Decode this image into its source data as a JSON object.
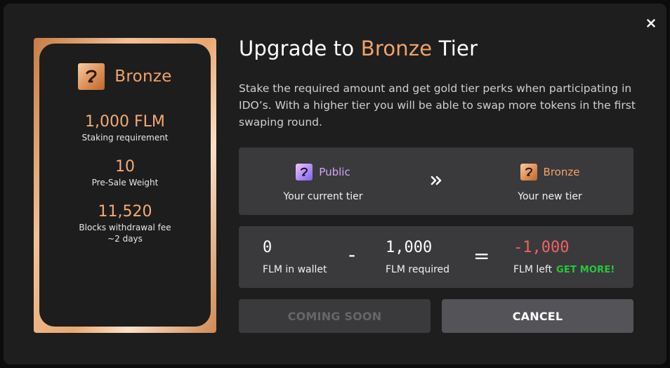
{
  "modal": {
    "close_icon": "close-icon",
    "title": {
      "prefix": "Upgrade to ",
      "tier": "Bronze",
      "suffix": " Tier"
    },
    "description": "Stake the required amount and get gold tier perks when participating in IDO’s. With a higher tier you will be able to swap more tokens in the first swaping round."
  },
  "card": {
    "name": "Bronze",
    "logo_icon": "bronze-tier-logo",
    "stats": [
      {
        "value": "1,000 FLM",
        "label": "Staking requirement"
      },
      {
        "value": "10",
        "label": "Pre-Sale Weight"
      },
      {
        "value": "11,520",
        "label": "Blocks withdrawal fee",
        "sublabel": "~2 days"
      }
    ]
  },
  "tiers": {
    "current": {
      "name": "Public",
      "caption": "Your current tier"
    },
    "new": {
      "name": "Bronze",
      "caption": "Your new tier"
    },
    "arrow_icon": "double-chevron-right-icon"
  },
  "calc": {
    "wallet": {
      "value": "0",
      "label": "FLM in wallet"
    },
    "minus": "-",
    "required": {
      "value": "1,000",
      "label": "FLM required"
    },
    "equals": "=",
    "left": {
      "value": "-1,000",
      "label": "FLM left"
    },
    "get_more": "GET MORE!"
  },
  "buttons": {
    "coming_soon": "COMING SOON",
    "cancel": "CANCEL"
  },
  "colors": {
    "accent": "#f1a36a",
    "negative": "#ef6363",
    "success": "#25c93a",
    "panel": "#3a3a3c",
    "modal_bg": "#1e1e1f"
  }
}
